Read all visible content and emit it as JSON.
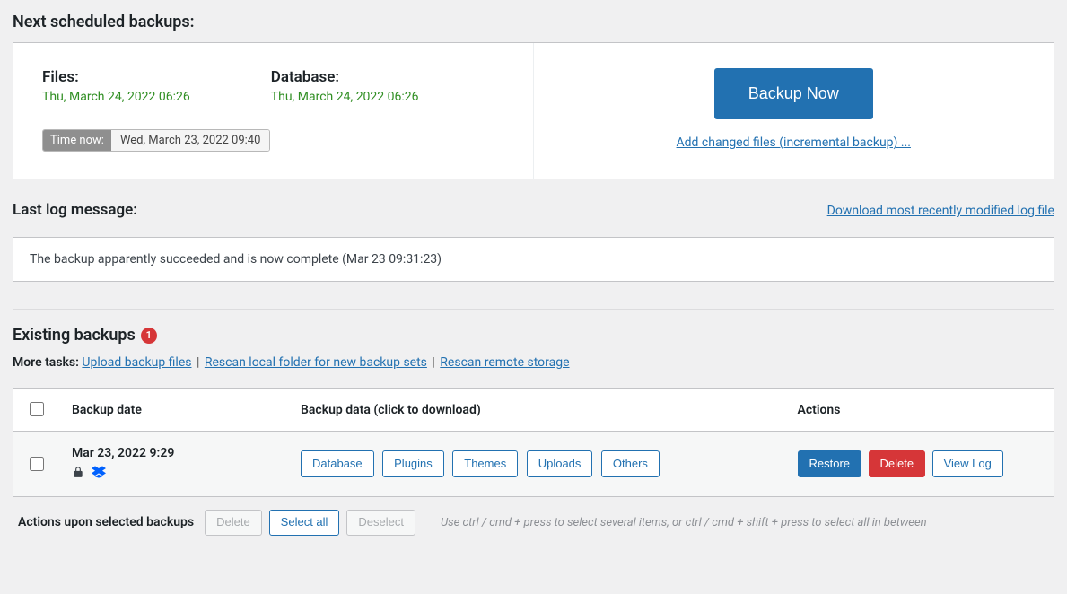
{
  "schedule": {
    "heading": "Next scheduled backups:",
    "files_label": "Files:",
    "files_time": "Thu, March 24, 2022 06:26",
    "database_label": "Database:",
    "database_time": "Thu, March 24, 2022 06:26",
    "time_now_label": "Time now:",
    "time_now_value": "Wed, March 23, 2022 09:40",
    "backup_now_button": "Backup Now",
    "incremental_link": "Add changed files (incremental backup) ..."
  },
  "log": {
    "heading": "Last log message:",
    "download_link": "Download most recently modified log file",
    "message": "The backup apparently succeeded and is now complete (Mar 23 09:31:23)"
  },
  "existing": {
    "heading": "Existing backups",
    "count": "1",
    "more_tasks_label": "More tasks:",
    "upload_link": "Upload backup files",
    "rescan_local_link": "Rescan local folder for new backup sets",
    "rescan_remote_link": "Rescan remote storage",
    "separator": " | "
  },
  "table": {
    "headers": {
      "date": "Backup date",
      "data": "Backup data (click to download)",
      "actions": "Actions"
    },
    "row": {
      "date": "Mar 23, 2022 9:29",
      "icons": {
        "lock": "lock-icon",
        "dropbox": "dropbox-icon"
      },
      "chips": {
        "database": "Database",
        "plugins": "Plugins",
        "themes": "Themes",
        "uploads": "Uploads",
        "others": "Others"
      },
      "actions": {
        "restore": "Restore",
        "delete": "Delete",
        "viewlog": "View Log"
      }
    }
  },
  "footer": {
    "label": "Actions upon selected backups",
    "delete": "Delete",
    "select_all": "Select all",
    "deselect": "Deselect",
    "hint": "Use ctrl / cmd + press to select several items, or ctrl / cmd + shift + press to select all in between"
  }
}
